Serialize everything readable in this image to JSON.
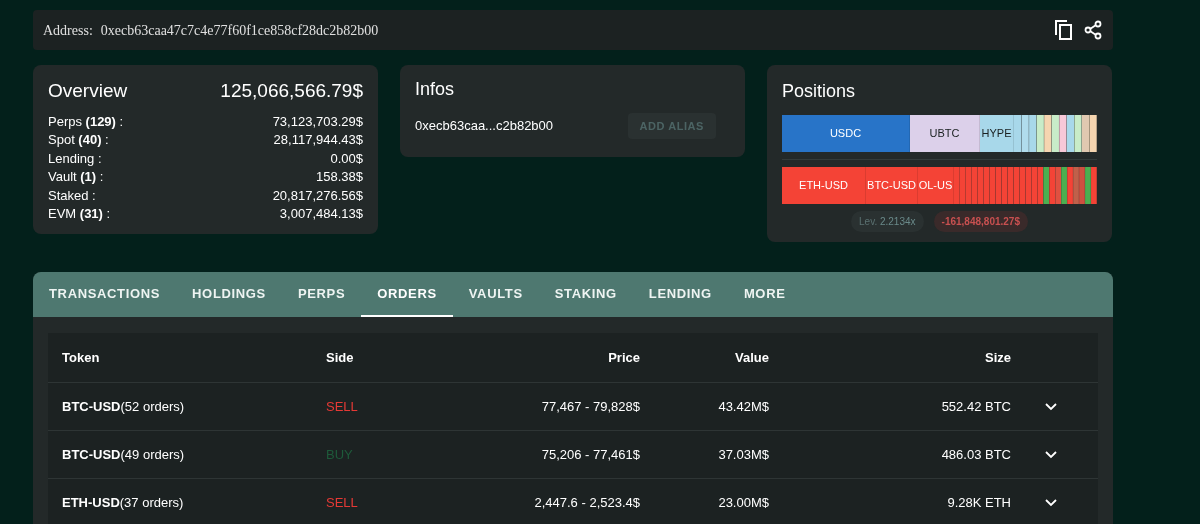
{
  "address_bar": {
    "label": "Address:",
    "address": "0xecb63caa47c7c4e77f60f1ce858cf28dc2b82b00"
  },
  "overview": {
    "title": "Overview",
    "total": "125,066,566.79$",
    "rows": [
      {
        "label": "Perps **(129)** :",
        "value": "73,123,703.29$"
      },
      {
        "label": "Spot **(40)** :",
        "value": "28,117,944.43$"
      },
      {
        "label": "Lending :",
        "value": "0.00$"
      },
      {
        "label": "Vault **(1)** :",
        "value": "158.38$"
      },
      {
        "label": "Staked :",
        "value": "20,817,276.56$"
      },
      {
        "label": "EVM **(31)** :",
        "value": "3,007,484.13$"
      }
    ]
  },
  "infos": {
    "title": "Infos",
    "address": "0xecb63caa...c2b82b00",
    "button": "ADD ALIAS"
  },
  "positions": {
    "title": "Positions",
    "spot_segments": [
      {
        "label": "USDC",
        "color": "#2874c8"
      },
      {
        "label": "UBTC",
        "color": "#dcd0ea"
      },
      {
        "label": "HYPE",
        "color": "#a8d8ea"
      }
    ],
    "perp_segments": [
      {
        "label": "ETH-USD",
        "color": "#f44336"
      },
      {
        "label": "BTC-USD",
        "color": "#f44336"
      },
      {
        "label": "OL-US",
        "color": "#f44336"
      }
    ],
    "leverage_label": "Lev.",
    "leverage": "2.2134x",
    "pnl": "-161,848,801.27$"
  },
  "tabs": [
    {
      "label": "TRANSACTIONS",
      "selected": false
    },
    {
      "label": "HOLDINGS",
      "selected": false
    },
    {
      "label": "PERPS",
      "selected": false
    },
    {
      "label": "ORDERS",
      "selected": true
    },
    {
      "label": "VAULTS",
      "selected": false
    },
    {
      "label": "STAKING",
      "selected": false
    },
    {
      "label": "LENDING",
      "selected": false
    },
    {
      "label": "MORE",
      "selected": false
    }
  ],
  "table": {
    "columns": [
      "Token",
      "Side",
      "Price",
      "Value",
      "Size"
    ],
    "rows": [
      {
        "token": "BTC-USD",
        "orders": "(52 orders)",
        "side": "SELL",
        "kind": "sell",
        "price": "77,467 - 79,828$",
        "value": "43.42M$",
        "size": "552.42 BTC"
      },
      {
        "token": "BTC-USD",
        "orders": "(49 orders)",
        "side": "BUY",
        "kind": "buy",
        "price": "75,206 - 77,461$",
        "value": "37.03M$",
        "size": "486.03 BTC"
      },
      {
        "token": "ETH-USD",
        "orders": "(37 orders)",
        "side": "SELL",
        "kind": "sell",
        "price": "2,447.6 - 2,523.4$",
        "value": "23.00M$",
        "size": "9.28K ETH"
      }
    ]
  }
}
